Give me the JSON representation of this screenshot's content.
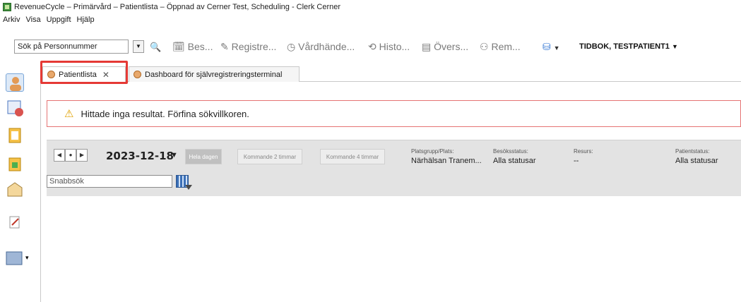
{
  "window": {
    "title": "RevenueCycle – Primärvård – Patientlista – Öppnad av Cerner Test, Scheduling - Clerk Cerner"
  },
  "menu": {
    "items": [
      "Arkiv",
      "Visa",
      "Uppgift",
      "Hjälp"
    ]
  },
  "toolbar": {
    "search_value": "Sök på Personnummer",
    "items": [
      {
        "label": "Bes...",
        "icon": "calendar-icon"
      },
      {
        "label": "Registre...",
        "icon": "pen-icon"
      },
      {
        "label": "Vårdhände...",
        "icon": "clock-icon"
      },
      {
        "label": "Histo...",
        "icon": "history-icon"
      },
      {
        "label": "Övers...",
        "icon": "overview-icon"
      },
      {
        "label": "Rem...",
        "icon": "referral-icon"
      }
    ],
    "patient_name": "TIDBOK, TESTPATIENT1"
  },
  "tabs": [
    {
      "label": "Patientlista",
      "active": true
    },
    {
      "label": "Dashboard för självregistreringsterminal",
      "active": false
    }
  ],
  "alert": {
    "message": "Hittade inga resultat. Förfina sökvillkoren."
  },
  "filters": {
    "date": "2023-12-18",
    "ranges": [
      "Hela dagen",
      "Kommande 2 timmar",
      "Kommande 4 timmar"
    ],
    "platsgrupp": {
      "label": "Platsgrupp/Plats:",
      "value": "Närhälsan Tranem..."
    },
    "besoksstatus": {
      "label": "Besöksstatus:",
      "value": "Alla statusar"
    },
    "resurs": {
      "label": "Resurs:",
      "value": "--"
    },
    "patientstatus": {
      "label": "Patientstatus:",
      "value": "Alla statusar"
    }
  },
  "quicksearch": {
    "value": "Snabbsök"
  },
  "colors": {
    "highlight": "#e53935",
    "alert_border": "#e57373",
    "filterbar": "#e3e3e3"
  }
}
